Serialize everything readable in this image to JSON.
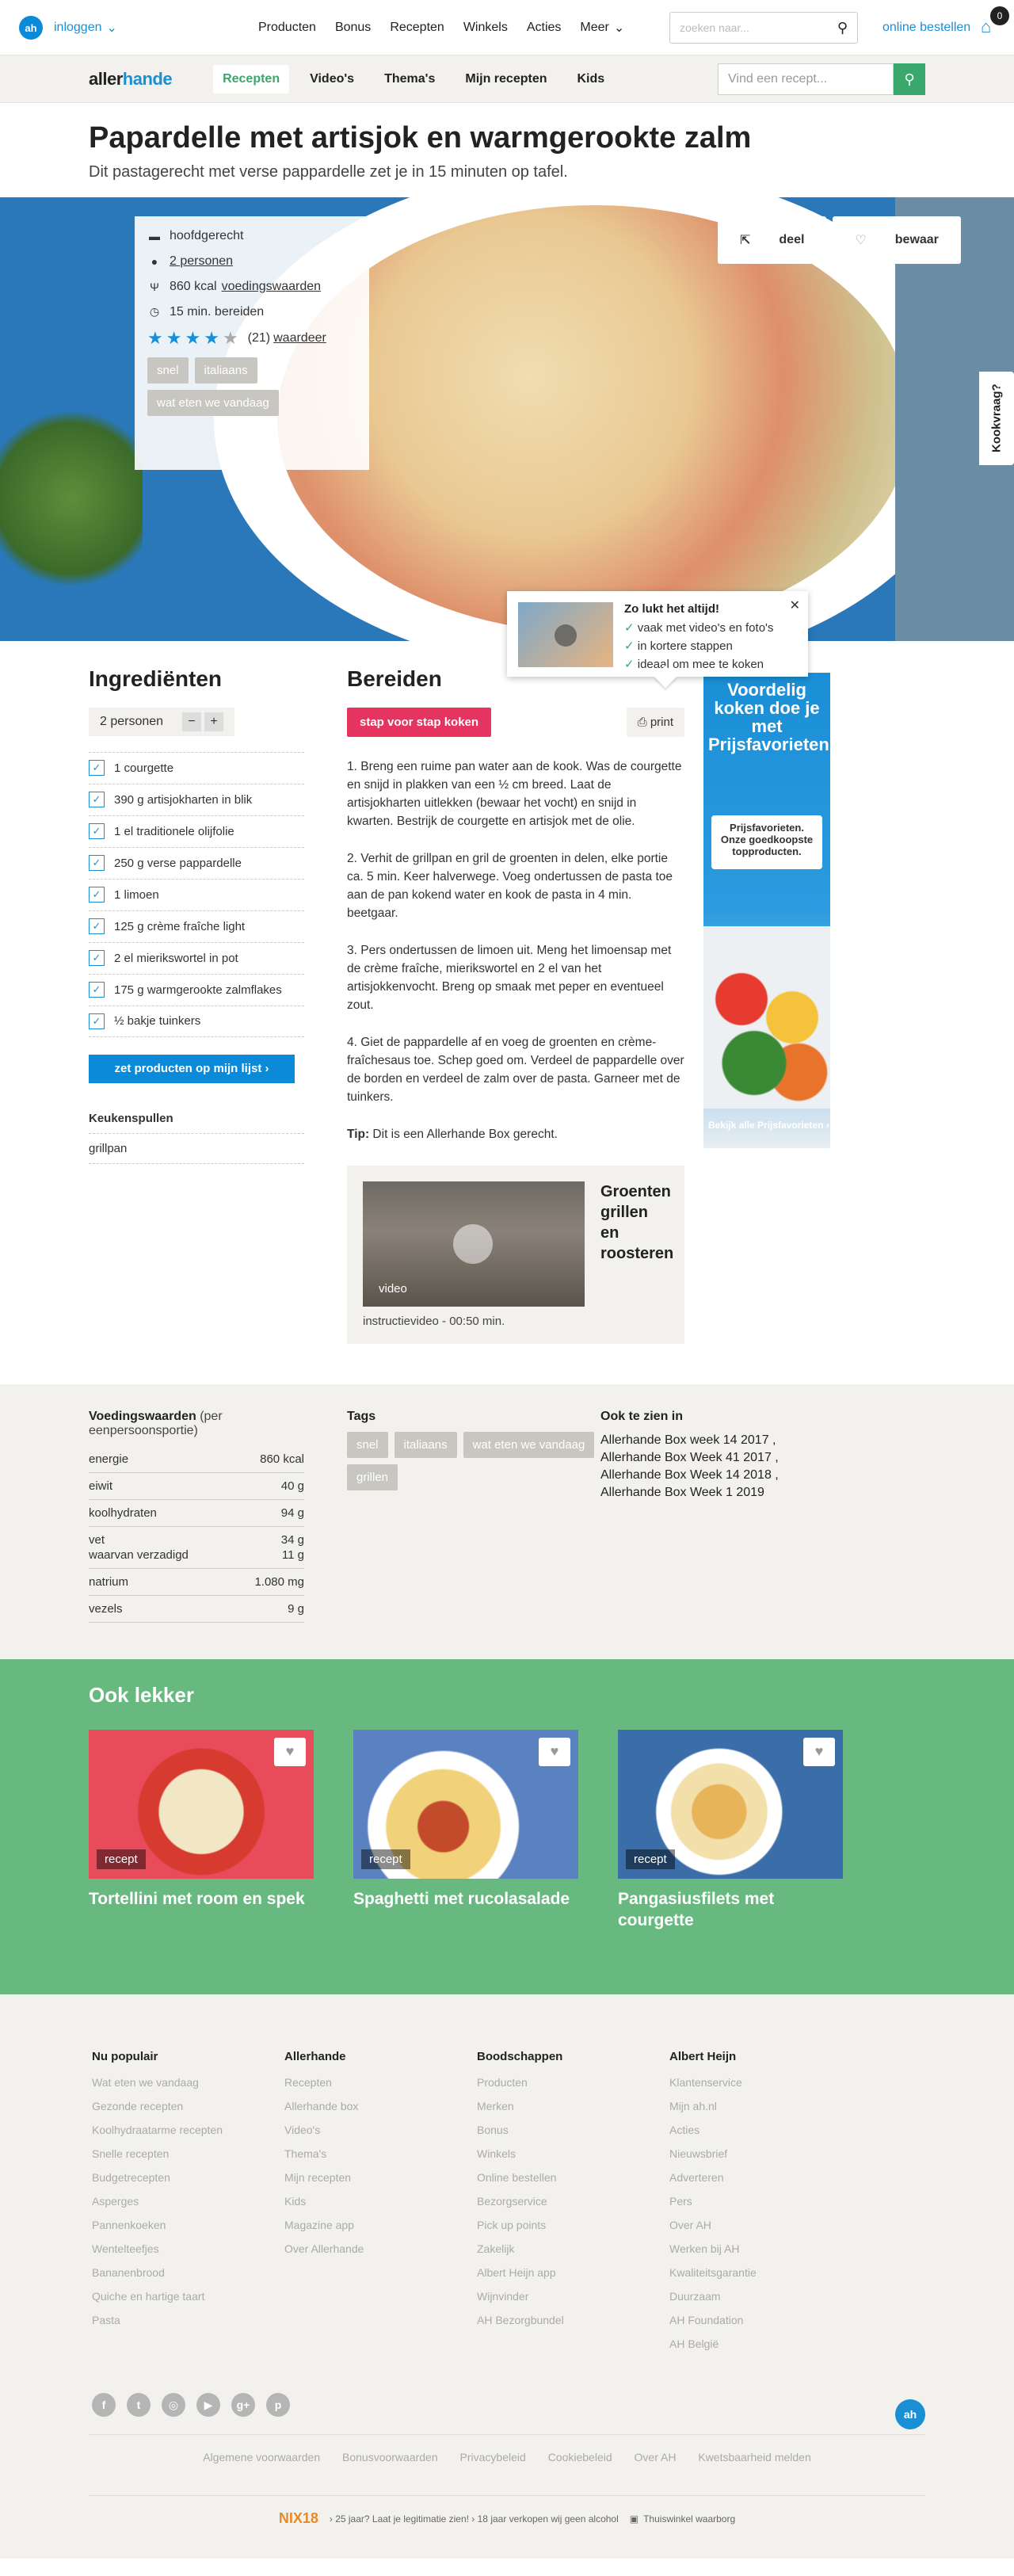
{
  "topbar": {
    "logo": "ah",
    "login": "inloggen",
    "nav": [
      "Producten",
      "Bonus",
      "Recepten",
      "Winkels",
      "Acties",
      "Meer"
    ],
    "search_placeholder": "zoeken naar...",
    "online": "online bestellen",
    "cart_count": "0"
  },
  "subnav": {
    "logo_a": "aller",
    "logo_b": "hande",
    "items": [
      "Recepten",
      "Video's",
      "Thema's",
      "Mijn recepten",
      "Kids"
    ],
    "search_placeholder": "Vind een recept..."
  },
  "recipe": {
    "title": "Papardelle met artisjok en warmgerookte zalm",
    "subtitle": "Dit pastagerecht met verse pappardelle zet je in 15 minuten op tafel.",
    "course": "hoofdgerecht",
    "persons": "2 personen",
    "kcal": "860 kcal",
    "nutri_link": "voedingswaarden",
    "time": "15 min. bereiden",
    "rating_count": "(21)",
    "rate_link": "waardeer",
    "rating": 4,
    "tags": [
      "snel",
      "italiaans",
      "wat eten we vandaag"
    ],
    "share": "deel",
    "save": "bewaar"
  },
  "kookvraag": "Kookvraag?",
  "popup": {
    "title": "Zo lukt het altijd!",
    "items": [
      "vaak met video's en foto's",
      "in kortere stappen",
      "ideaal om mee te koken"
    ]
  },
  "ingredients": {
    "title": "Ingrediënten",
    "persons": "2 personen",
    "list": [
      "1 courgette",
      "390 g artisjokharten in blik",
      "1 el traditionele olijfolie",
      "250 g verse pappardelle",
      "1 limoen",
      "125 g crème fraîche light",
      "2 el mierikswortel in pot",
      "175 g warmgerookte zalmflakes",
      "½ bakje tuinkers"
    ],
    "button": "zet producten op mijn lijst  ›",
    "tools_title": "Keukenspullen",
    "tools": "grillpan"
  },
  "prep": {
    "title": "Bereiden",
    "step_button": "stap voor stap koken",
    "print": "print",
    "steps": [
      "1. Breng een ruime pan water aan de kook. Was de courgette en snijd in plakken van een ½ cm breed. Laat de artisjokharten uitlekken (bewaar het vocht) en snijd in kwarten. Bestrijk de courgette en artisjok met de olie.",
      "2. Verhit de grillpan en gril de groenten in delen, elke portie ca. 5 min. Keer halverwege. Voeg ondertussen de pasta toe aan de pan kokend water en kook de pasta in 4 min. beetgaar.",
      "3. Pers ondertussen de limoen uit. Meng het limoensap met de crème fraîche, mierikswortel en 2 el van het artisjokkenvocht. Breng op smaak met peper en eventueel zout.",
      "4. Giet de pappardelle af en voeg de groenten en crème-fraîchesaus toe. Schep goed om. Verdeel de pappardelle over de borden en verdeel de zalm over de pasta. Garneer met de tuinkers."
    ],
    "tip_label": "Tip:",
    "tip": " Dit is een Allerhande Box gerecht.",
    "video_title": "Groenten grillen en roosteren",
    "video_label": "video",
    "video_caption": "instructievideo - 00:50 min."
  },
  "ad": {
    "headline": "Voordelig koken doe je met Prijsfavorieten",
    "card": "Prijsfavorieten. Onze goedkoopste topproducten.",
    "link": "Bekijk alle Prijsfavorieten ›"
  },
  "nutrition": {
    "title": "Voedingswaarden",
    "title_note": "(per eenpersoonsportie)",
    "rows": [
      {
        "label": "energie",
        "value": "860 kcal"
      },
      {
        "label": "eiwit",
        "value": "40 g"
      },
      {
        "label": "koolhydraten",
        "value": "94 g"
      },
      {
        "label": "vet",
        "value": "34 g"
      },
      {
        "label": "waarvan verzadigd",
        "value": "11 g"
      },
      {
        "label": "natrium",
        "value": "1.080 mg"
      },
      {
        "label": "vezels",
        "value": "9 g"
      }
    ],
    "tags_title": "Tags",
    "tags": [
      "snel",
      "italiaans",
      "wat eten we vandaag",
      "grillen"
    ],
    "also_title": "Ook te zien in",
    "also": [
      "Allerhande Box week 14 2017 ,",
      "Allerhande Box Week 41 2017 ,",
      "Allerhande Box Week 14 2018 ,",
      "Allerhande Box Week 1 2019"
    ]
  },
  "more": {
    "title": "Ook lekker",
    "badge": "recept",
    "cards": [
      "Tortellini met room en spek",
      "Spaghetti met rucolasalade",
      "Pangasiusfilets met courgette"
    ]
  },
  "footer": {
    "cols": [
      {
        "title": "Nu populair",
        "links": [
          "Wat eten we vandaag",
          "Gezonde recepten",
          "Koolhydraatarme recepten",
          "Snelle recepten",
          "Budgetrecepten",
          "Asperges",
          "Pannenkoeken",
          "Wentelteefjes",
          "Bananenbrood",
          "Quiche en hartige taart",
          "Pasta"
        ]
      },
      {
        "title": "Allerhande",
        "links": [
          "Recepten",
          "Allerhande box",
          "Video's",
          "Thema's",
          "Mijn recepten",
          "Kids",
          "Magazine app",
          "Over Allerhande"
        ]
      },
      {
        "title": "Boodschappen",
        "links": [
          "Producten",
          "Merken",
          "Bonus",
          "Winkels",
          "Online bestellen",
          "Bezorgservice",
          "Pick up points",
          "Zakelijk",
          "Albert Heijn app",
          "Wijnvinder",
          "AH Bezorgbundel"
        ]
      },
      {
        "title": "Albert Heijn",
        "links": [
          "Klantenservice",
          "Mijn ah.nl",
          "Acties",
          "Nieuwsbrief",
          "Adverteren",
          "Pers",
          "Over AH",
          "Werken bij AH",
          "Kwaliteitsgarantie",
          "Duurzaam",
          "AH Foundation",
          "AH België"
        ]
      }
    ],
    "bottom_links": [
      "Algemene voorwaarden",
      "Bonusvoorwaarden",
      "Privacybeleid",
      "Cookiebeleid",
      "Over AH",
      "Kwetsbaarheid melden"
    ],
    "nix_logo": "NIX18",
    "nix_text": "› 25 jaar? Laat je legitimatie zien! › 18 jaar verkopen wij geen alcohol",
    "thuiswinkel": "Thuiswinkel waarborg"
  }
}
